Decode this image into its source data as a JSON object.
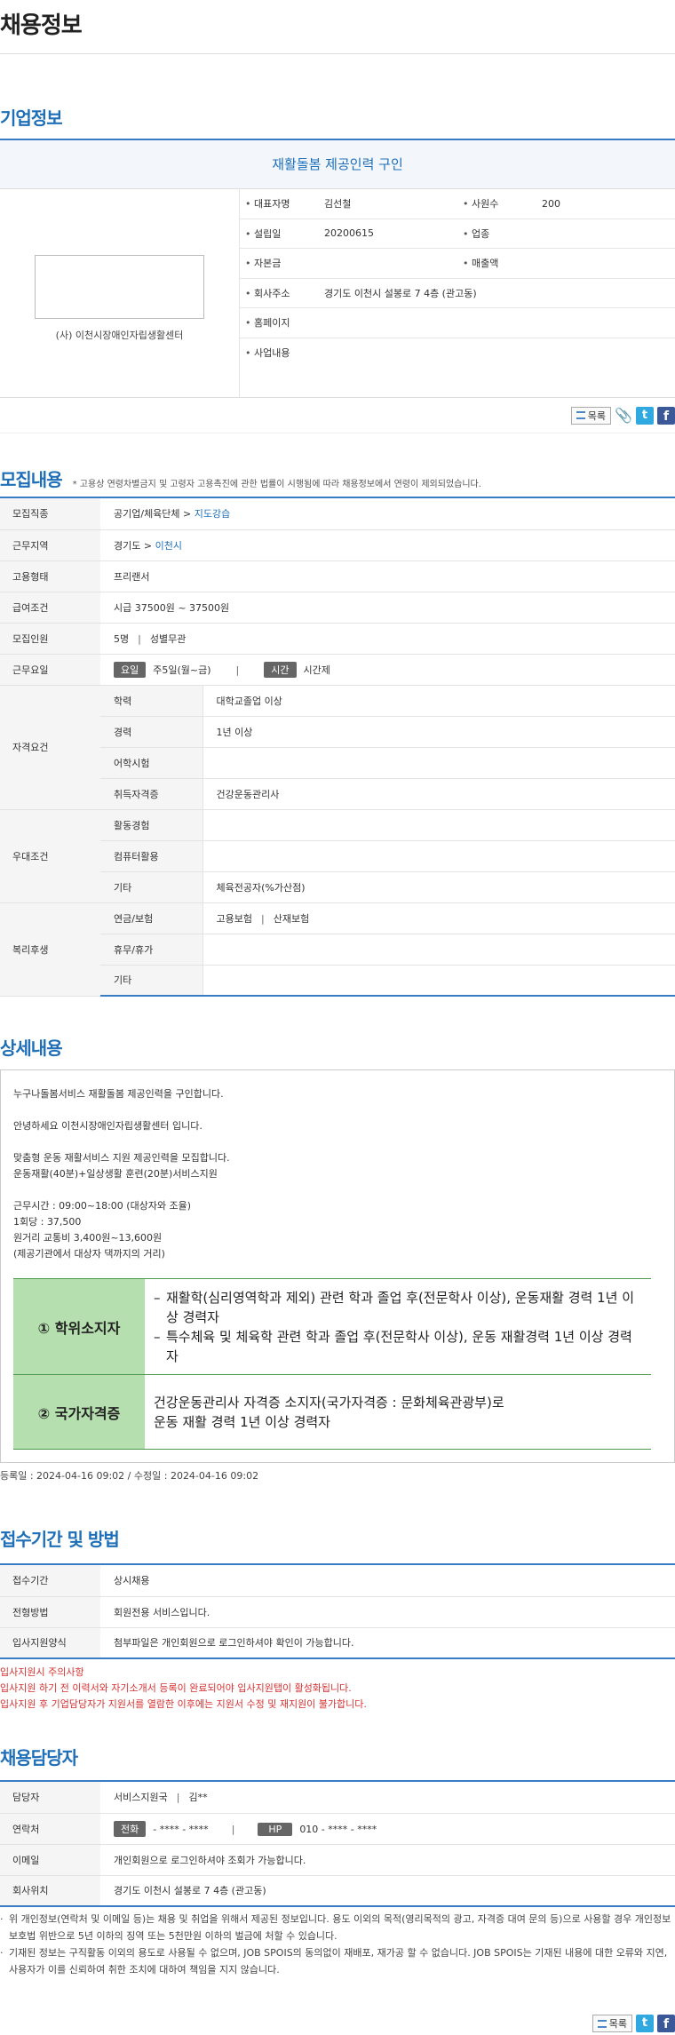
{
  "page_title": "채용정보",
  "company": {
    "section_title": "기업정보",
    "job_title": "재활돌봄 제공인력 구인",
    "name": "(사) 이천시장애인자립생활센터",
    "rep_label": "대표자명",
    "rep_value": "김선철",
    "emp_label": "사원수",
    "emp_value": "200",
    "est_label": "설립일",
    "est_value": "20200615",
    "industry_label": "업종",
    "industry_value": "",
    "capital_label": "자본금",
    "capital_value": "",
    "sales_label": "매출액",
    "sales_value": "",
    "addr_label": "회사주소",
    "addr_value": "경기도 이천시 설봉로 7 4층 (관고동)",
    "home_label": "홈페이지",
    "home_value": "",
    "biz_label": "사업내용",
    "biz_value": ""
  },
  "toolbar": {
    "list_label": "목록",
    "icons": [
      "list-icon",
      "clip-icon",
      "twitter-icon",
      "facebook-icon"
    ]
  },
  "recruit": {
    "section_title": "모집내용",
    "note": "* 고용상 연령차별금지 및 고령자 고용촉진에 관한 법률이 시행됨에 따라 채용정보에서 연령이 제외되었습니다.",
    "field_label": "모집직종",
    "field_main": "공기업/체육단체",
    "field_arrow": ">",
    "field_sub": "지도강습",
    "region_label": "근무지역",
    "region_main": "경기도",
    "region_arrow": ">",
    "region_sub": "이천시",
    "type_label": "고용형태",
    "type_value": "프리랜서",
    "pay_label": "급여조건",
    "pay_value": "시급 37500원 ~ 37500원",
    "count_label": "모집인원",
    "count_value": "5명",
    "gender_value": "성별무관",
    "sep": "|",
    "days_label": "근무요일",
    "days_chip": "요일",
    "days_value": "주5일(월~금)",
    "time_chip": "시간",
    "time_value": "시간제",
    "qual_label": "자격요건",
    "qual_rows": [
      {
        "label": "학력",
        "value": "대학교졸업 이상"
      },
      {
        "label": "경력",
        "value": "1년 이상"
      },
      {
        "label": "어학시험",
        "value": ""
      },
      {
        "label": "취득자격증",
        "value": "건강운동관리사"
      }
    ],
    "pref_label": "우대조건",
    "pref_rows": [
      {
        "label": "활동경험",
        "value": ""
      },
      {
        "label": "컴퓨터활용",
        "value": ""
      },
      {
        "label": "기타",
        "value": "체육전공자(%가산점)"
      }
    ],
    "welfare_label": "복리후생",
    "welfare_rows": [
      {
        "label": "연금/보험",
        "value_a": "고용보험",
        "value_b": "산재보험"
      },
      {
        "label": "휴무/휴가",
        "value_a": "",
        "value_b": ""
      },
      {
        "label": "기타",
        "value_a": "",
        "value_b": ""
      }
    ]
  },
  "detail": {
    "section_title": "상세내용",
    "lines": [
      "누구나돌봄서비스 재활돌봄 제공인력을 구인합니다.",
      "",
      "안녕하세요 이천시장애인자립생활센터 입니다.",
      "",
      "맞춤형 운동 재활서비스 지원 제공인력을 모집합니다.",
      "운동재활(40분)+일상생활 훈련(20분)서비스지원",
      "",
      "근무시간 : 09:00~18:00 (대상자와 조율)",
      "1회당 : 37,500",
      "원거리 교통비 3,400원~13,600원",
      "(제공기관에서 대상자 댁까지의 거리)"
    ],
    "q1_head": "① 학위소지자",
    "q1_items": [
      "재활학(심리영역학과 제외) 관련 학과 졸업 후(전문학사 이상), 운동재활 경력 1년 이상 경력자",
      "특수체육 및 체육학 관련 학과 졸업 후(전문학사 이상), 운동 재활경력 1년 이상 경력자"
    ],
    "dash": "–",
    "q2_head": "② 국가자격증",
    "q2_line1": "건강운동관리사 자격증 소지자(국가자격증 : 문화체육관광부)로",
    "q2_line2": "운동 재활 경력 1년 이상 경력자",
    "reg_date": "등록일 : 2024-04-16 09:02 / 수정일 : 2024-04-16 09:02"
  },
  "receipt": {
    "section_title": "접수기간 및 방법",
    "period_label": "접수기간",
    "period_value": "상시채용",
    "method_label": "전형방법",
    "method_value": "회원전용 서비스입니다.",
    "form_label": "입사지원양식",
    "form_value": "첨부파일은 개인회원으로 로그인하셔야 확인이 가능합니다.",
    "warn_title": "입사지원시 주의사항",
    "warn_1": "입사지원 하기 전 이력서와 자기소개서 등록이 완료되어야 입사지원탭이 활성화됩니다.",
    "warn_2": "입사지원 후 기업담당자가 지원서를 열람한 이후에는 지원서 수정 및 재지원이 불가합니다."
  },
  "contact": {
    "section_title": "채용담당자",
    "person_label": "담당자",
    "person_dept": "서비스지원국",
    "person_name": "김**",
    "phone_label": "연락처",
    "tel_chip": "전화",
    "tel_value": "- **** - ****",
    "hp_chip": "HP",
    "hp_value": "010 - **** - ****",
    "email_label": "이메일",
    "email_value": "개인회원으로 로그인하셔야 조회가 가능합니다.",
    "loc_label": "회사위치",
    "loc_value": "경기도 이천시 설봉로 7 4층 (관고동)",
    "bullet": "·",
    "note_1": "위 개인정보(연락처 및 이메일 등)는 채용 및 취업을 위해서 제공된 정보입니다. 용도 이외의 목적(영리목적의 광고, 자격증 대여 문의 등)으로 사용할 경우 개인정보보호법 위반으로 5년 이하의 징역 또는 5천만원 이하의 벌금에 처할 수 있습니다.",
    "note_2": "기재된 정보는 구직활동 이외의 용도로 사용될 수 없으며, JOB SPOIS의 동의없이 재배포, 재가공 할 수 없습니다. JOB SPOIS는 기재된 내용에 대한 오류와 지연, 사용자가 이를 신뢰하여 취한 조치에 대하여 책임을 지지 않습니다."
  }
}
